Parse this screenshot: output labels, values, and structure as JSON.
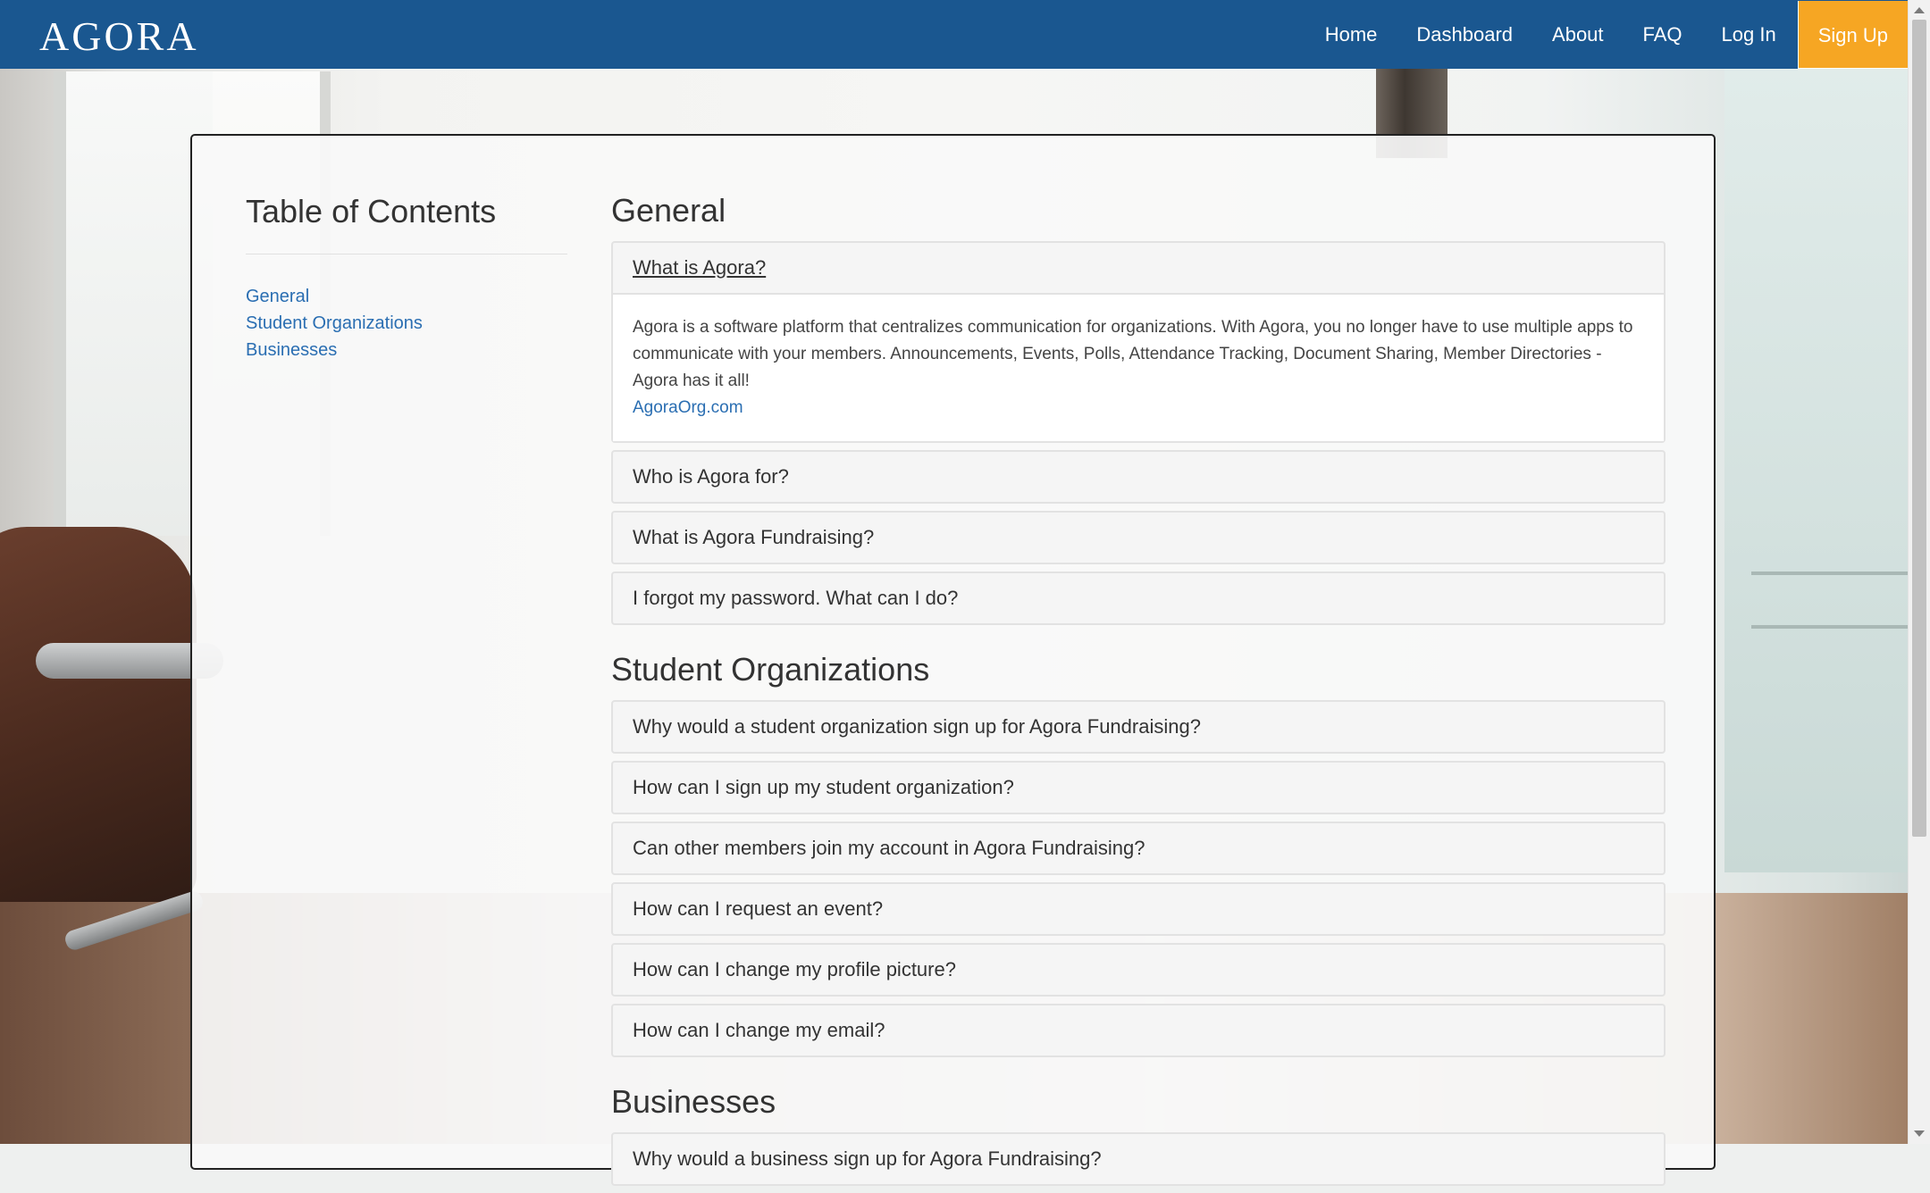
{
  "nav": {
    "brand": "AGORA",
    "links": [
      "Home",
      "Dashboard",
      "About",
      "FAQ",
      "Log In"
    ],
    "signup": "Sign Up"
  },
  "toc": {
    "title": "Table of Contents",
    "items": [
      "General",
      "Student Organizations",
      "Businesses"
    ]
  },
  "sections": {
    "general": {
      "title": "General",
      "open_question": "What is Agora?",
      "open_answer": "Agora is a software platform that centralizes communication for organizations. With Agora, you no longer have to use multiple apps to communicate with your members. Announcements, Events, Polls, Attendance Tracking, Document Sharing, Member Directories - Agora has it all!",
      "open_answer_link": "AgoraOrg.com",
      "questions": [
        "Who is Agora for?",
        "What is Agora Fundraising?",
        "I forgot my password. What can I do?"
      ]
    },
    "student": {
      "title": "Student Organizations",
      "questions": [
        "Why would a student organization sign up for Agora Fundraising?",
        "How can I sign up my student organization?",
        "Can other members join my account in Agora Fundraising?",
        "How can I request an event?",
        "How can I change my profile picture?",
        "How can I change my email?"
      ]
    },
    "business": {
      "title": "Businesses",
      "questions": [
        "Why would a business sign up for Agora Fundraising?"
      ]
    }
  }
}
